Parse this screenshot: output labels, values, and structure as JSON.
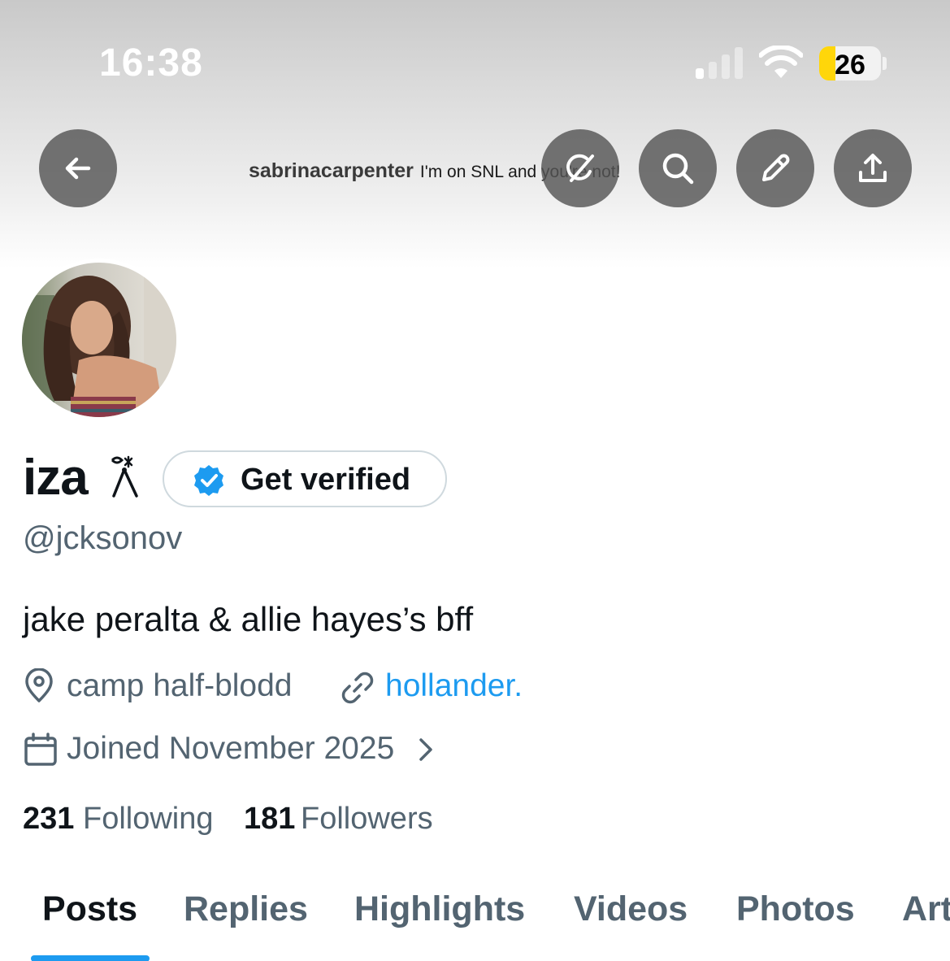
{
  "status_bar": {
    "time": "16:38",
    "battery_level": "26",
    "battery_fraction": 0.26,
    "signal_bars_active": 1,
    "signal_bars_total": 4
  },
  "banner": {
    "username": "sabrinacarpenter",
    "message": "I'm on SNL and you're not!"
  },
  "header_buttons": {
    "back_icon": "arrow-left-icon",
    "grok_icon": "grok-icon",
    "search_icon": "search-icon",
    "edit_icon": "pencil-icon",
    "share_icon": "share-icon"
  },
  "profile": {
    "name": "iza",
    "name_emoji": "lobster-claw-emoji",
    "get_verified_label": "Get verified",
    "handle": "@jcksonov",
    "bio": "jake peralta & allie hayes’s bff",
    "location": "camp half-blodd",
    "website": "hollander.",
    "joined": "Joined November 2025",
    "following_count": "231",
    "following_label": "Following",
    "followers_count": "181",
    "followers_label": "Followers"
  },
  "tabs": [
    {
      "label": "Posts",
      "active": true
    },
    {
      "label": "Replies",
      "active": false
    },
    {
      "label": "Highlights",
      "active": false
    },
    {
      "label": "Videos",
      "active": false
    },
    {
      "label": "Photos",
      "active": false
    },
    {
      "label": "Articles",
      "active": false
    }
  ],
  "colors": {
    "accent": "#1d9bf0",
    "secondary_text": "#536471",
    "primary_text": "#0f1419",
    "battery_fill": "#ffd60a"
  }
}
